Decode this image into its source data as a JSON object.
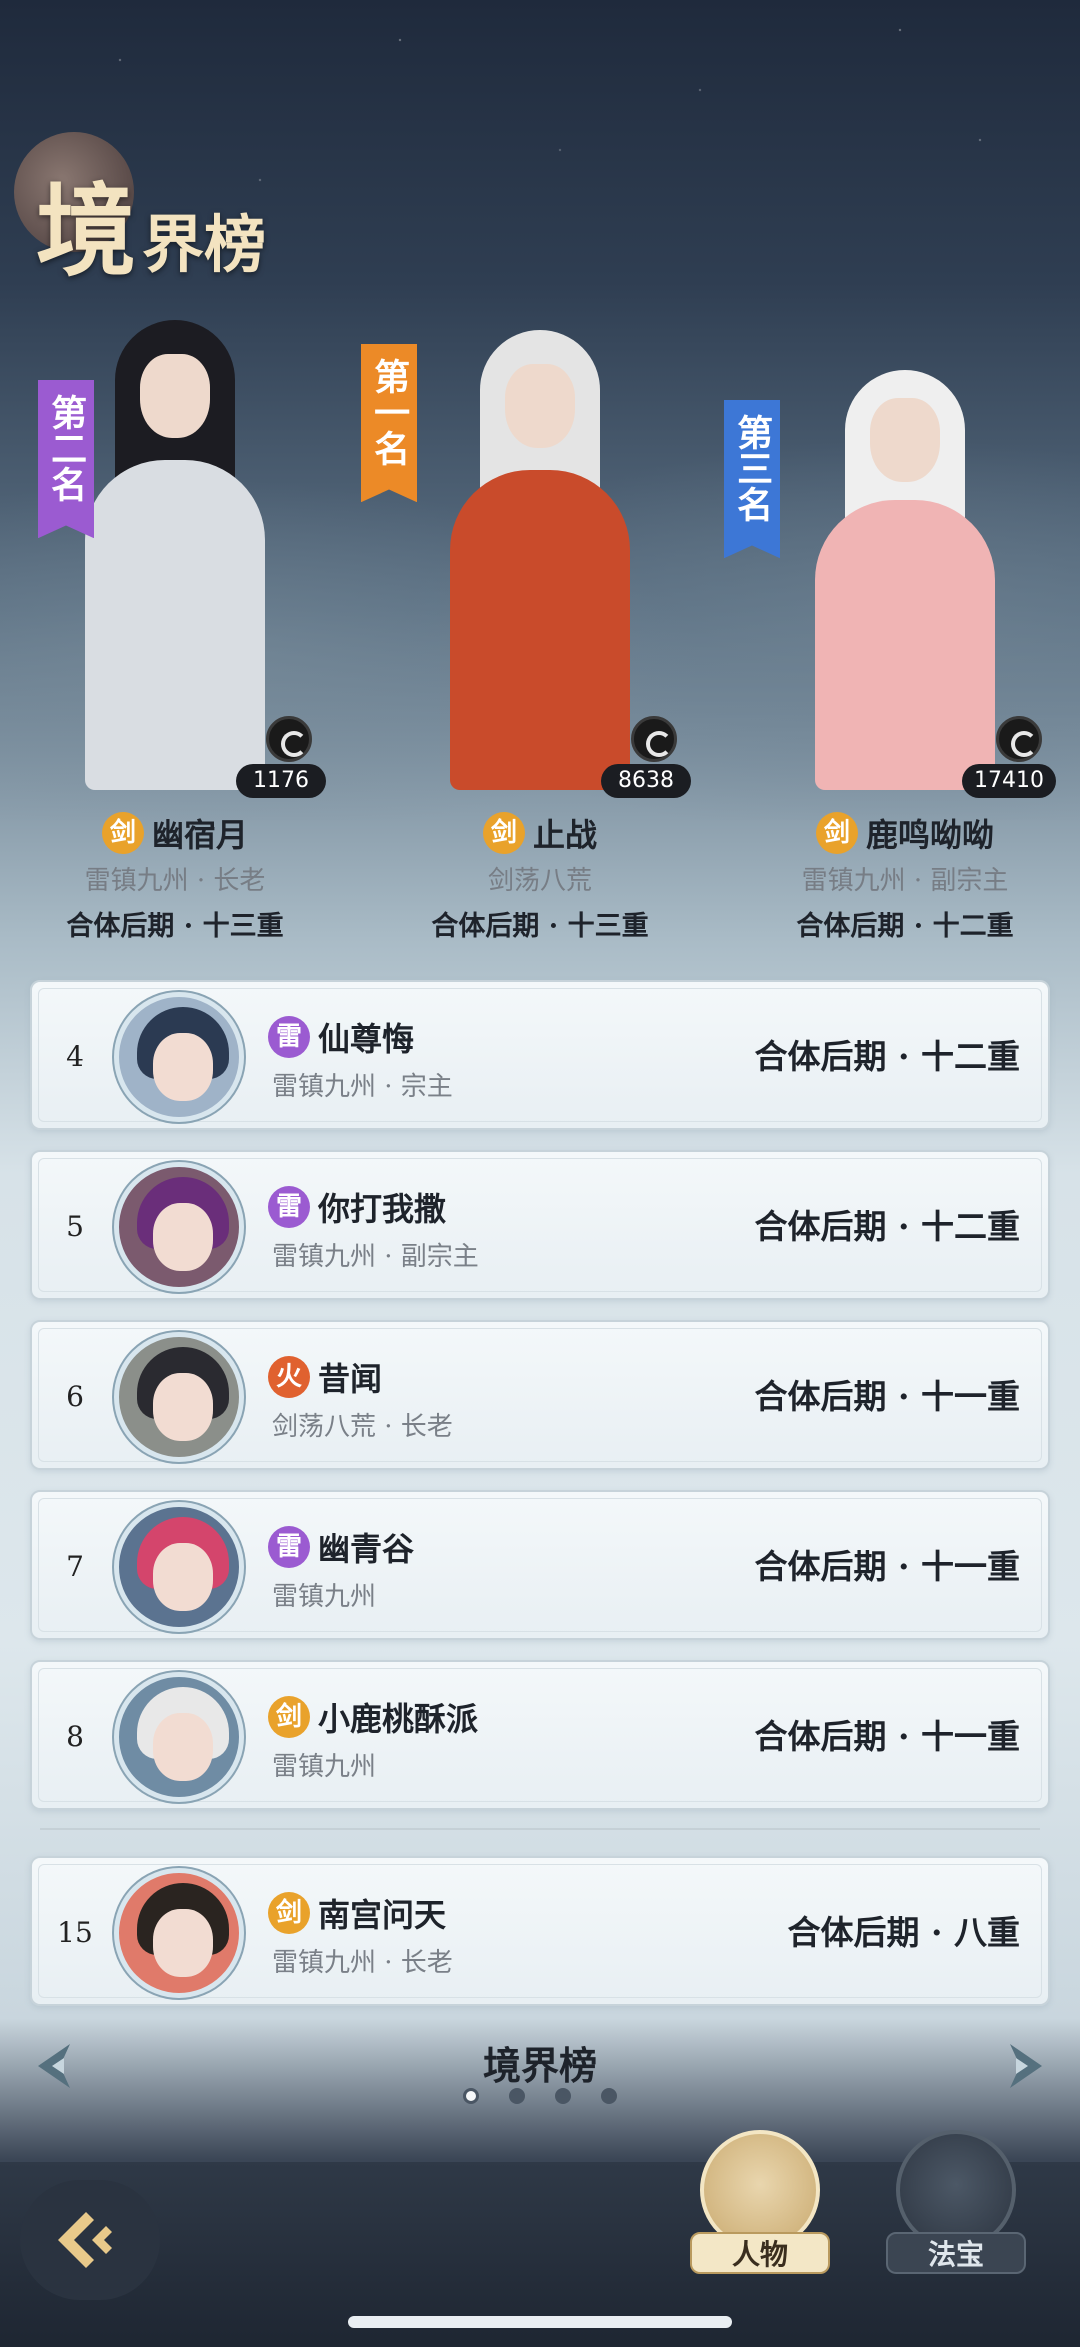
{
  "header": {
    "title_big": "境",
    "title_rest": "界榜"
  },
  "podium": [
    {
      "rank_label": "第二名",
      "rank_color": "#9b5bd1",
      "power": "1176",
      "element": "剑",
      "element_type": "sword",
      "name": "幽宿月",
      "sect": "雷镇九州 · 长老",
      "realm": "合体后期 · 十三重",
      "hair_color": "#1c1c22",
      "robe_color": "#d9dde2"
    },
    {
      "rank_label": "第一名",
      "rank_color": "#ec8a27",
      "power": "8638",
      "element": "剑",
      "element_type": "sword",
      "name": "止战",
      "sect": "剑荡八荒",
      "realm": "合体后期 · 十三重",
      "hair_color": "#e4e4e4",
      "robe_color": "#c94b2b"
    },
    {
      "rank_label": "第三名",
      "rank_color": "#3d77d6",
      "power": "17410",
      "element": "剑",
      "element_type": "sword",
      "name": "鹿鸣呦呦",
      "sect": "雷镇九州 · 副宗主",
      "realm": "合体后期 · 十二重",
      "hair_color": "#efefef",
      "robe_color": "#f0b4b4"
    }
  ],
  "rows": [
    {
      "rank": "4",
      "element": "雷",
      "element_type": "thunder",
      "name": "仙尊悔",
      "sect": "雷镇九州 · 宗主",
      "realm": "合体后期 · 十二重",
      "hair_color": "#2b3a52",
      "avatar_bg": "#9fb3c8"
    },
    {
      "rank": "5",
      "element": "雷",
      "element_type": "thunder",
      "name": "你打我撒",
      "sect": "雷镇九州 · 副宗主",
      "realm": "合体后期 · 十二重",
      "hair_color": "#6a2e7a",
      "avatar_bg": "#7b5a6e"
    },
    {
      "rank": "6",
      "element": "火",
      "element_type": "fire",
      "name": "昔闻",
      "sect": "剑荡八荒 · 长老",
      "realm": "合体后期 · 十一重",
      "hair_color": "#2a2a30",
      "avatar_bg": "#8b8f8a"
    },
    {
      "rank": "7",
      "element": "雷",
      "element_type": "thunder",
      "name": "幽青谷",
      "sect": "雷镇九州",
      "realm": "合体后期 · 十一重",
      "hair_color": "#d4456c",
      "avatar_bg": "#5b7390"
    },
    {
      "rank": "8",
      "element": "剑",
      "element_type": "sword",
      "name": "小鹿桃酥派",
      "sect": "雷镇九州",
      "realm": "合体后期 · 十一重",
      "hair_color": "#e8e8e8",
      "avatar_bg": "#6f8ca4"
    },
    {
      "rank": "15",
      "element": "剑",
      "element_type": "sword",
      "name": "南宫问天",
      "sect": "雷镇九州 · 长老",
      "realm": "合体后期 · 八重",
      "hair_color": "#2a2420",
      "avatar_bg": "#e07a6a"
    }
  ],
  "pager": {
    "title": "境界榜",
    "page_count": 4,
    "current_page": 1
  },
  "tabs": [
    {
      "label": "人物",
      "selected": true
    },
    {
      "label": "法宝",
      "selected": false
    }
  ]
}
